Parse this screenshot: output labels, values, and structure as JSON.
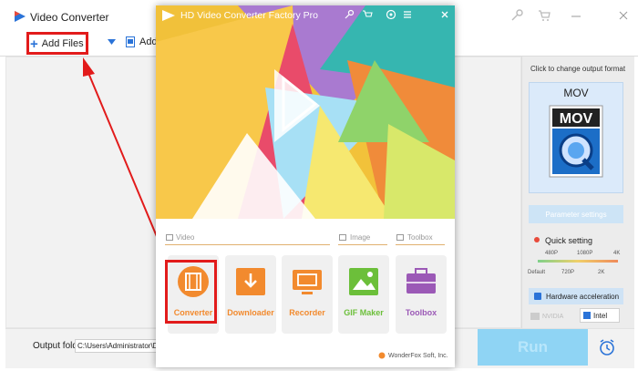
{
  "app": {
    "title": "Video Converter",
    "toolbar": {
      "add_files_label": "Add Files",
      "add_video_label": "Add Vid"
    },
    "output": {
      "label": "Output folder:",
      "path_value": "C:\\Users\\Administrator\\Deskto"
    },
    "run_label": "Run",
    "right_panel": {
      "hint": "Click to change output format",
      "format": "MOV",
      "format_icon_text": "MOV",
      "parameter_settings_label": "Parameter settings",
      "quick_setting_label": "Quick setting",
      "ticks_top": [
        "480P",
        "1080P",
        "4K"
      ],
      "ticks_bottom": [
        "Default",
        "720P",
        "2K"
      ],
      "hw_accel_label": "Hardware acceleration",
      "nvidia_label": "NVIDIA",
      "intel_label": "Intel"
    }
  },
  "popup": {
    "title": "HD Video Converter Factory Pro",
    "sections": {
      "video": "Video",
      "image": "Image",
      "toolbox": "Toolbox"
    },
    "tiles": [
      {
        "label": "Converter",
        "icon": "film-icon",
        "color": "#f28a2e"
      },
      {
        "label": "Downloader",
        "icon": "download-icon",
        "color": "#f28a2e"
      },
      {
        "label": "Recorder",
        "icon": "screen-record-icon",
        "color": "#f28a2e"
      },
      {
        "label": "GIF Maker",
        "icon": "image-icon",
        "color": "#6cbf3a"
      },
      {
        "label": "Toolbox",
        "icon": "toolbox-icon",
        "color": "#9b59b6"
      }
    ],
    "brand": "WonderFox Soft, Inc."
  },
  "colors": {
    "accent_blue": "#2a73d8",
    "highlight_red": "#e21b1b",
    "orange": "#f28a2e",
    "green": "#6cbf3a",
    "purple": "#9b59b6"
  }
}
